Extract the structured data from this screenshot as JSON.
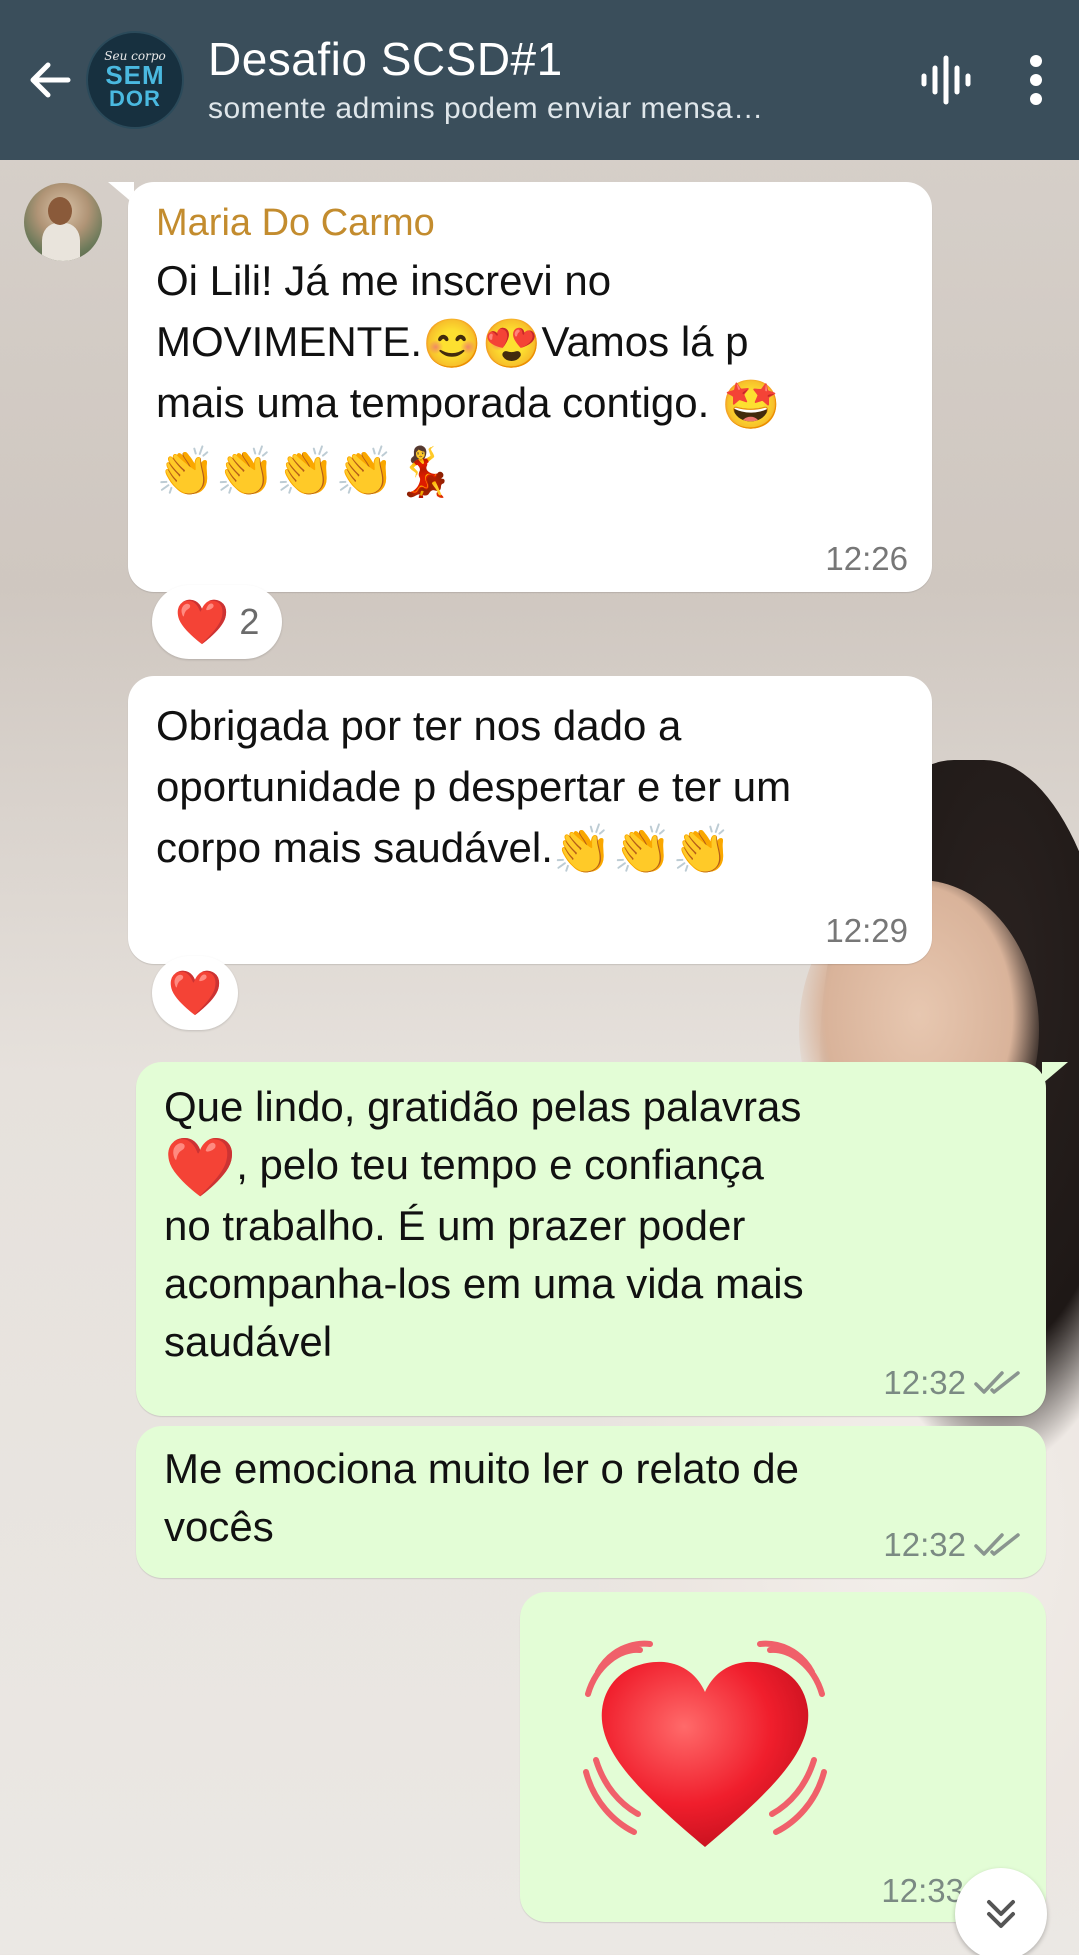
{
  "header": {
    "title": "Desafio SCSD#1",
    "subtitle": "somente admins podem enviar mensa…",
    "avatar_text": [
      "Seu corpo",
      "SEM",
      "DOR"
    ],
    "background": "#3a4e5b"
  },
  "messages": [
    {
      "sender": "Maria Do Carmo",
      "text_lines": [
        "Oi Lili! Já me inscrevi no",
        "MOVIMENTE.",
        "Vamos lá p",
        "mais uma temporada contigo."
      ],
      "emojis": {
        "line2": [
          "😊",
          "😍"
        ],
        "line3_end": "🤩",
        "line4": [
          "👏",
          "👏",
          "👏",
          "👏",
          "💃"
        ]
      },
      "time": "12:26",
      "reaction": {
        "emoji": "❤️",
        "count": "2"
      }
    },
    {
      "text": "Obrigada por ter nos dado a oportunidade p despertar e ter um corpo mais saudável.",
      "text_lines": [
        "Obrigada por ter nos dado a",
        "oportunidade p despertar e ter um",
        "corpo mais saudável."
      ],
      "emojis": [
        "👏",
        "👏",
        "👏"
      ],
      "time": "12:29",
      "reaction": {
        "emoji": "❤️"
      }
    },
    {
      "text_lines": [
        "Que lindo, gratidão pelas palavras",
        ", pelo teu tempo e confiança",
        "no trabalho. É um prazer poder",
        "acompanha-los em uma vida mais",
        "saudável"
      ],
      "emoji": "❤️",
      "time": "12:32"
    },
    {
      "text_lines": [
        "Me emociona muito ler o relato de",
        "vocês"
      ],
      "time": "12:32"
    },
    {
      "big_emoji": "💓",
      "time": "12:33"
    }
  ],
  "colors": {
    "incoming_bubble": "#ffffff",
    "outgoing_bubble": "#e3fdd6",
    "sender_name": "#c38c2e",
    "read_check": "#8a958f"
  },
  "icons": [
    "back-arrow-icon",
    "group-avatar",
    "voice-chat-icon",
    "more-menu-icon",
    "double-check-icon",
    "scroll-down-icon"
  ]
}
